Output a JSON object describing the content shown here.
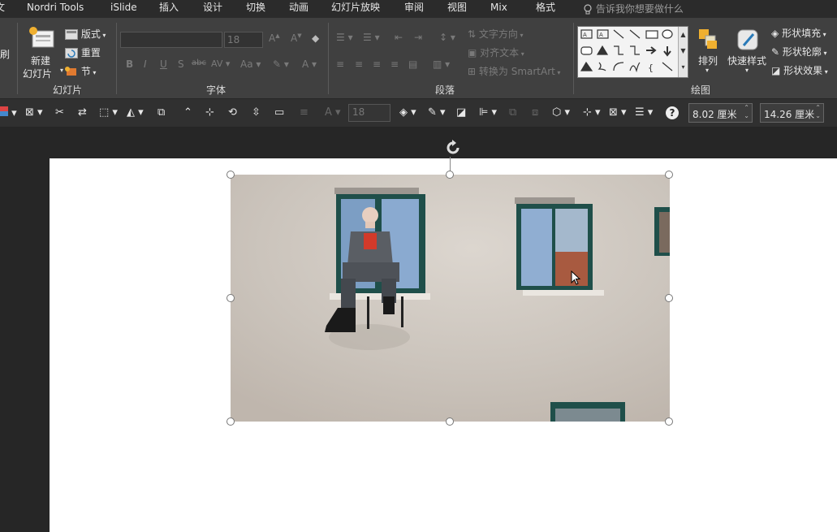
{
  "tabs": [
    {
      "label": "文"
    },
    {
      "label": "Nordri Tools"
    },
    {
      "label": "iSlide"
    },
    {
      "label": "插入"
    },
    {
      "label": "设计"
    },
    {
      "label": "切换"
    },
    {
      "label": "动画"
    },
    {
      "label": "幻灯片放映"
    },
    {
      "label": "审阅"
    },
    {
      "label": "视图"
    },
    {
      "label": "Mix"
    },
    {
      "label": "格式"
    }
  ],
  "tell_me": "告诉我你想要做什么",
  "ribbon": {
    "clipboard_fragment": "刷",
    "slides_group": {
      "label": "幻灯片",
      "new_slide_line1": "新建",
      "new_slide_line2": "幻灯片",
      "layout": "版式",
      "reset": "重置",
      "section": "节"
    },
    "font_group": {
      "label": "字体",
      "font_size": "18"
    },
    "paragraph_group": {
      "label": "段落",
      "text_direction": "文字方向",
      "align_text": "对齐文本",
      "convert_smartart": "转换为 SmartArt"
    },
    "drawing_group": {
      "label": "绘图",
      "arrange": "排列",
      "quick_styles": "快速样式",
      "shape_fill": "形状填充",
      "shape_outline": "形状轮廓",
      "shape_effects": "形状效果"
    }
  },
  "toolbar2": {
    "font_size": "18",
    "height_value": "8.02 厘米",
    "width_value": "14.26 厘米",
    "help_icon": "?"
  },
  "colors": {
    "tabbar": "#2b2b2b",
    "ribbon": "#404040",
    "canvas": "#262626",
    "slide": "#ffffff",
    "window_frame": "#1f4f4a"
  }
}
